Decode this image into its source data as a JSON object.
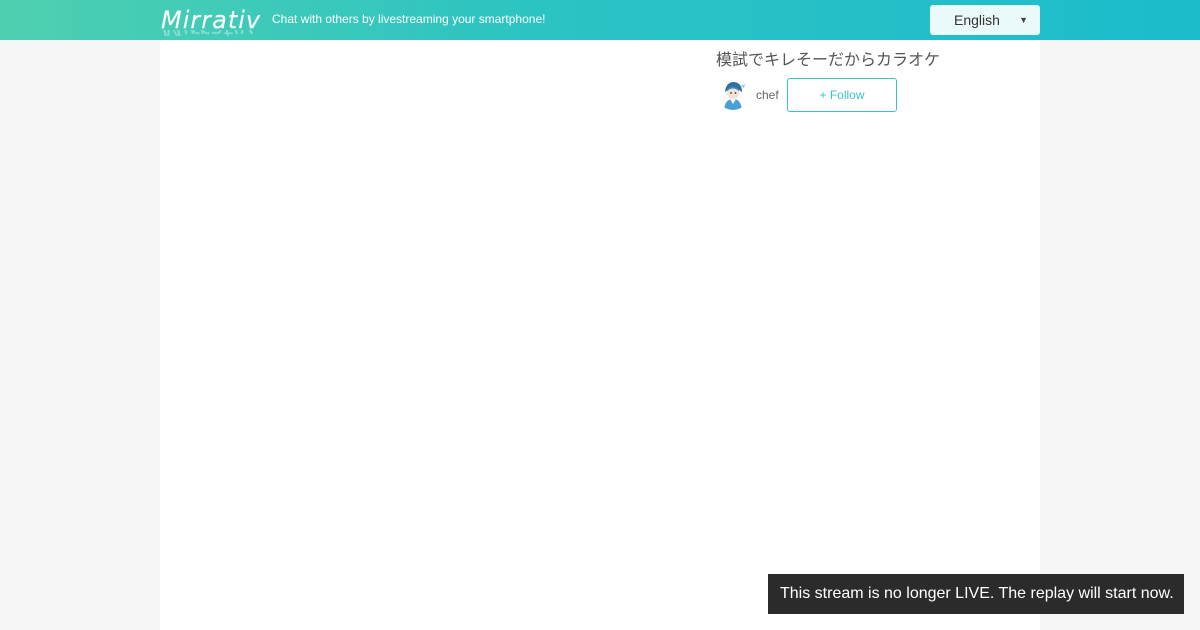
{
  "header": {
    "logo_text": "Mirrativ",
    "tagline": "Chat with others by livestreaming your smartphone!",
    "language": {
      "selected": "English",
      "arrow_icon": "dropdown-arrow-icon"
    },
    "gradient_start": "#4fd0b0",
    "gradient_end": "#1cbccc"
  },
  "stream": {
    "title": "模試でキレそーだからカラオケ",
    "streamer": {
      "name": "chef",
      "avatar_icon": "user-avatar"
    },
    "follow_label": "+ Follow"
  },
  "toast": {
    "message": "This stream is no longer LIVE. The replay will start now."
  },
  "colors": {
    "accent": "#3cc4c4",
    "toast_bg": "#2b2b2b"
  }
}
